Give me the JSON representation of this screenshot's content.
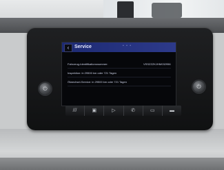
{
  "screen": {
    "title": "Service",
    "back_icon": "chevron-left-icon",
    "rows": [
      {
        "label": "Fahrzeug-Identifikationsnummer:",
        "value": "VSSZZZKJHM032956"
      },
      {
        "label": "Inspektion: in 29500 km oder 721 Tagen",
        "value": ""
      },
      {
        "label": "Ölwechsel-Service: in 29500 km oder 721 Tagen",
        "value": ""
      }
    ]
  },
  "softkeys": [
    {
      "name": "menu",
      "icon": "///"
    },
    {
      "name": "car",
      "icon": "▣"
    },
    {
      "name": "media",
      "icon": "▷"
    },
    {
      "name": "phone",
      "icon": "✆"
    },
    {
      "name": "nav",
      "icon": "▭"
    },
    {
      "name": "settings",
      "icon": "▬"
    }
  ],
  "knobs": {
    "left_icon": "power-icon",
    "right_icon": "power-icon"
  }
}
